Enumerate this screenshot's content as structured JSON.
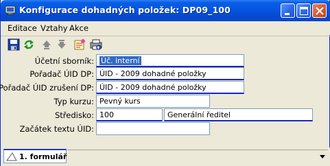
{
  "window": {
    "title": "Konfigurace dohadných položek: DP09_100",
    "controls": [
      "minimize",
      "maximize",
      "close"
    ]
  },
  "menu": {
    "items": [
      "Editace",
      "Vztahy",
      "Akce"
    ]
  },
  "toolbar": {
    "tools": [
      "save-icon",
      "refresh-icon",
      "move-up-icon",
      "move-down-icon",
      "note-icon",
      "print-preview-icon"
    ]
  },
  "form": {
    "ucetni_sbornik": {
      "label": "Účetní sborník:",
      "value": "Úč. interní"
    },
    "poradac_uid_dp": {
      "label": "Pořadač ÚID DP:",
      "value": "ÚID - 2009 dohadné položky"
    },
    "poradac_uid_zruseni": {
      "label": "Pořadač ÚID zrušení DP:",
      "value": "ÚID - 2009 dohadné položky"
    },
    "typ_kurzu": {
      "label": "Typ kurzu:",
      "value": "Pevný kurs"
    },
    "stredisko": {
      "label": "Středisko:",
      "code": "100",
      "name": "Generální ředitel"
    },
    "zacatek_textu": {
      "label": "Začátek textu ÚID:",
      "value": ""
    }
  },
  "status": {
    "tab_label": "1. formulář"
  },
  "colors": {
    "title_bar": "#0555e0",
    "selection": "#316ac5",
    "field_underline": "#1327c8",
    "window_bg": "#ece9d8"
  }
}
